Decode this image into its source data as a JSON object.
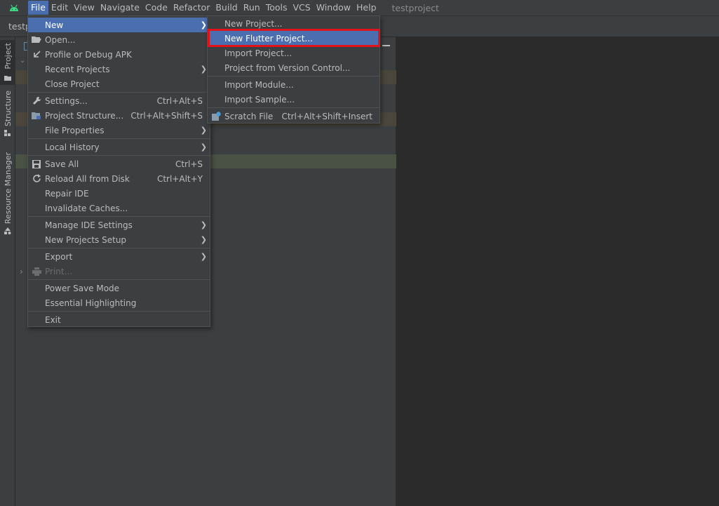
{
  "menubar": {
    "items": [
      "File",
      "Edit",
      "View",
      "Navigate",
      "Code",
      "Refactor",
      "Build",
      "Run",
      "Tools",
      "VCS",
      "Window",
      "Help"
    ],
    "window_title": "testproject"
  },
  "navbar": {
    "project": "testp"
  },
  "toolwindows": {
    "project": "Project",
    "structure": "Structure",
    "resource_manager": "Resource Manager"
  },
  "file_menu": {
    "new": "New",
    "open": "Open...",
    "profile_apk": "Profile or Debug APK",
    "recent_projects": "Recent Projects",
    "close_project": "Close Project",
    "settings": "Settings...",
    "settings_sc": "Ctrl+Alt+S",
    "project_structure": "Project Structure...",
    "project_structure_sc": "Ctrl+Alt+Shift+S",
    "file_properties": "File Properties",
    "local_history": "Local History",
    "save_all": "Save All",
    "save_all_sc": "Ctrl+S",
    "reload": "Reload All from Disk",
    "reload_sc": "Ctrl+Alt+Y",
    "repair": "Repair IDE",
    "invalidate": "Invalidate Caches...",
    "manage_settings": "Manage IDE Settings",
    "new_projects_setup": "New Projects Setup",
    "export": "Export",
    "print": "Print...",
    "power_save": "Power Save Mode",
    "essential_hl": "Essential Highlighting",
    "exit": "Exit"
  },
  "new_menu": {
    "new_project": "New Project...",
    "new_flutter": "New Flutter Project...",
    "import_project": "Import Project...",
    "from_vcs": "Project from Version Control...",
    "import_module": "Import Module...",
    "import_sample": "Import Sample...",
    "scratch": "Scratch File",
    "scratch_sc": "Ctrl+Alt+Shift+Insert"
  },
  "colors": {
    "highlight": "#4b6eaf",
    "annotation_box": "#e0131b",
    "android_green": "#3ddc84"
  }
}
